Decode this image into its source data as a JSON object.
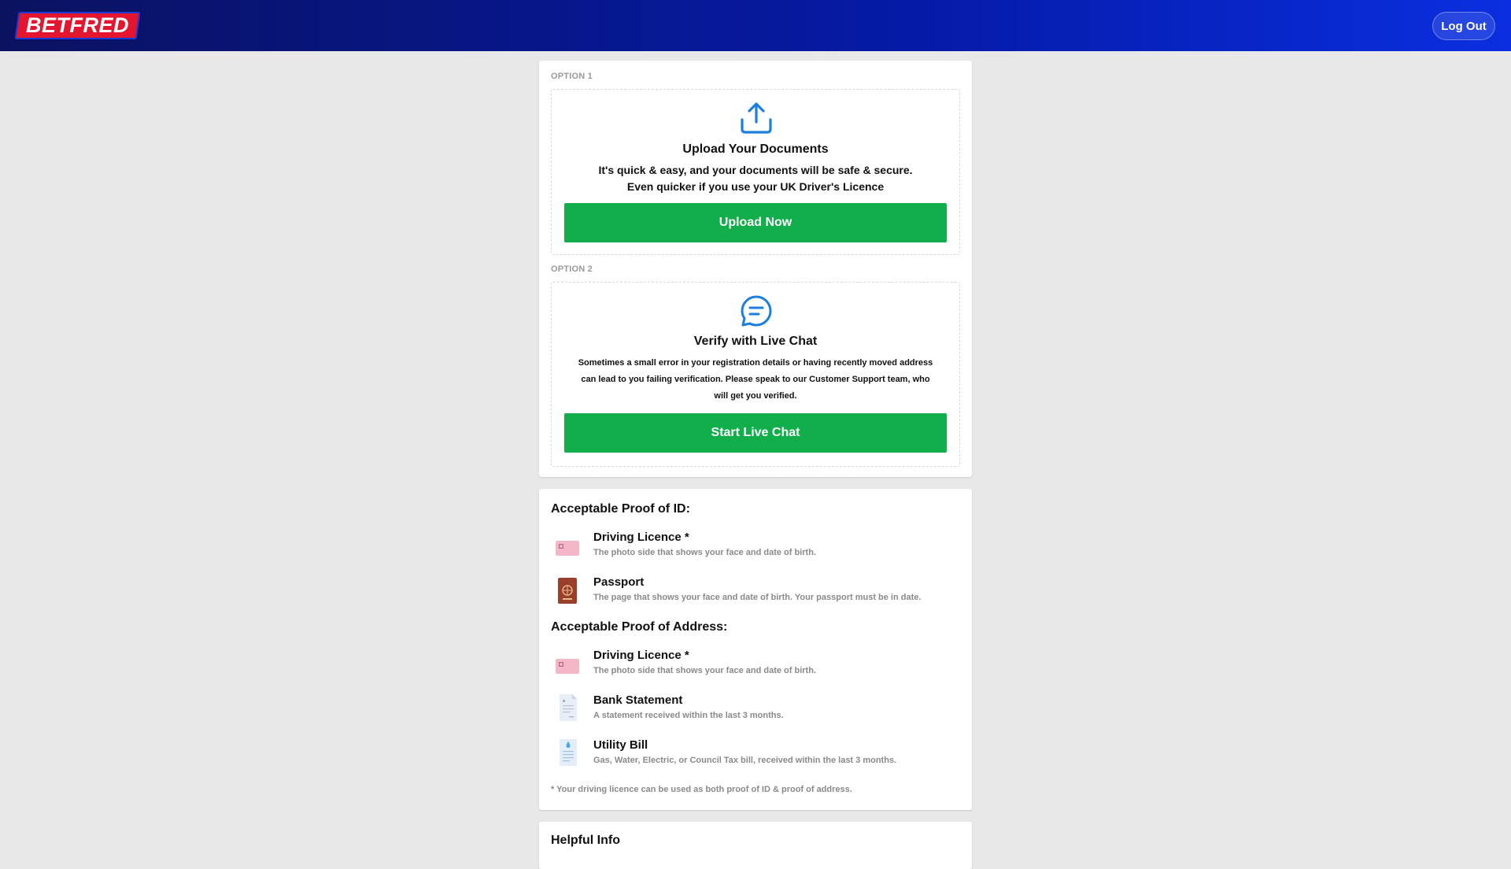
{
  "header": {
    "logo_text": "BETFRED",
    "logout_label": "Log Out"
  },
  "options": [
    {
      "label": "OPTION 1",
      "icon": "upload-icon",
      "title": "Upload Your Documents",
      "text_line1": "It's quick & easy, and your documents will be safe & secure.",
      "text_line2": "Even quicker if you use your UK Driver's Licence",
      "button": "Upload Now"
    },
    {
      "label": "OPTION 2",
      "icon": "chat-icon",
      "title": "Verify with Live Chat",
      "text_line1": "Sometimes a small error in your registration details or having recently moved address",
      "text_line2": "can lead to you failing verification. Please speak to our Customer Support team, who",
      "text_line3": "will get you verified.",
      "button": "Start Live Chat"
    }
  ],
  "proof_of_id": {
    "title": "Acceptable Proof of ID:",
    "items": [
      {
        "icon": "driving-licence-icon",
        "name": "Driving Licence *",
        "desc": "The photo side that shows your face and date of birth."
      },
      {
        "icon": "passport-icon",
        "name": "Passport",
        "desc": "The page that shows your face and date of birth. Your passport must be in date."
      }
    ]
  },
  "proof_of_address": {
    "title": "Acceptable Proof of Address:",
    "items": [
      {
        "icon": "driving-licence-icon",
        "name": "Driving Licence *",
        "desc": "The photo side that shows your face and date of birth."
      },
      {
        "icon": "bank-statement-icon",
        "name": "Bank Statement",
        "desc": "A statement received within the last 3 months."
      },
      {
        "icon": "utility-bill-icon",
        "name": "Utility Bill",
        "desc": "Gas, Water, Electric, or Council Tax bill, received within the last 3 months."
      }
    ]
  },
  "footnote": "* Your driving licence can be used as both proof of ID & proof of address.",
  "helpful_info": {
    "title": "Helpful Info"
  },
  "colors": {
    "header_start": "#0a1260",
    "header_end": "#0a2fe0",
    "logo_red": "#e4162f",
    "button_green": "#12ae4b",
    "icon_blue": "#1a7fe0"
  }
}
